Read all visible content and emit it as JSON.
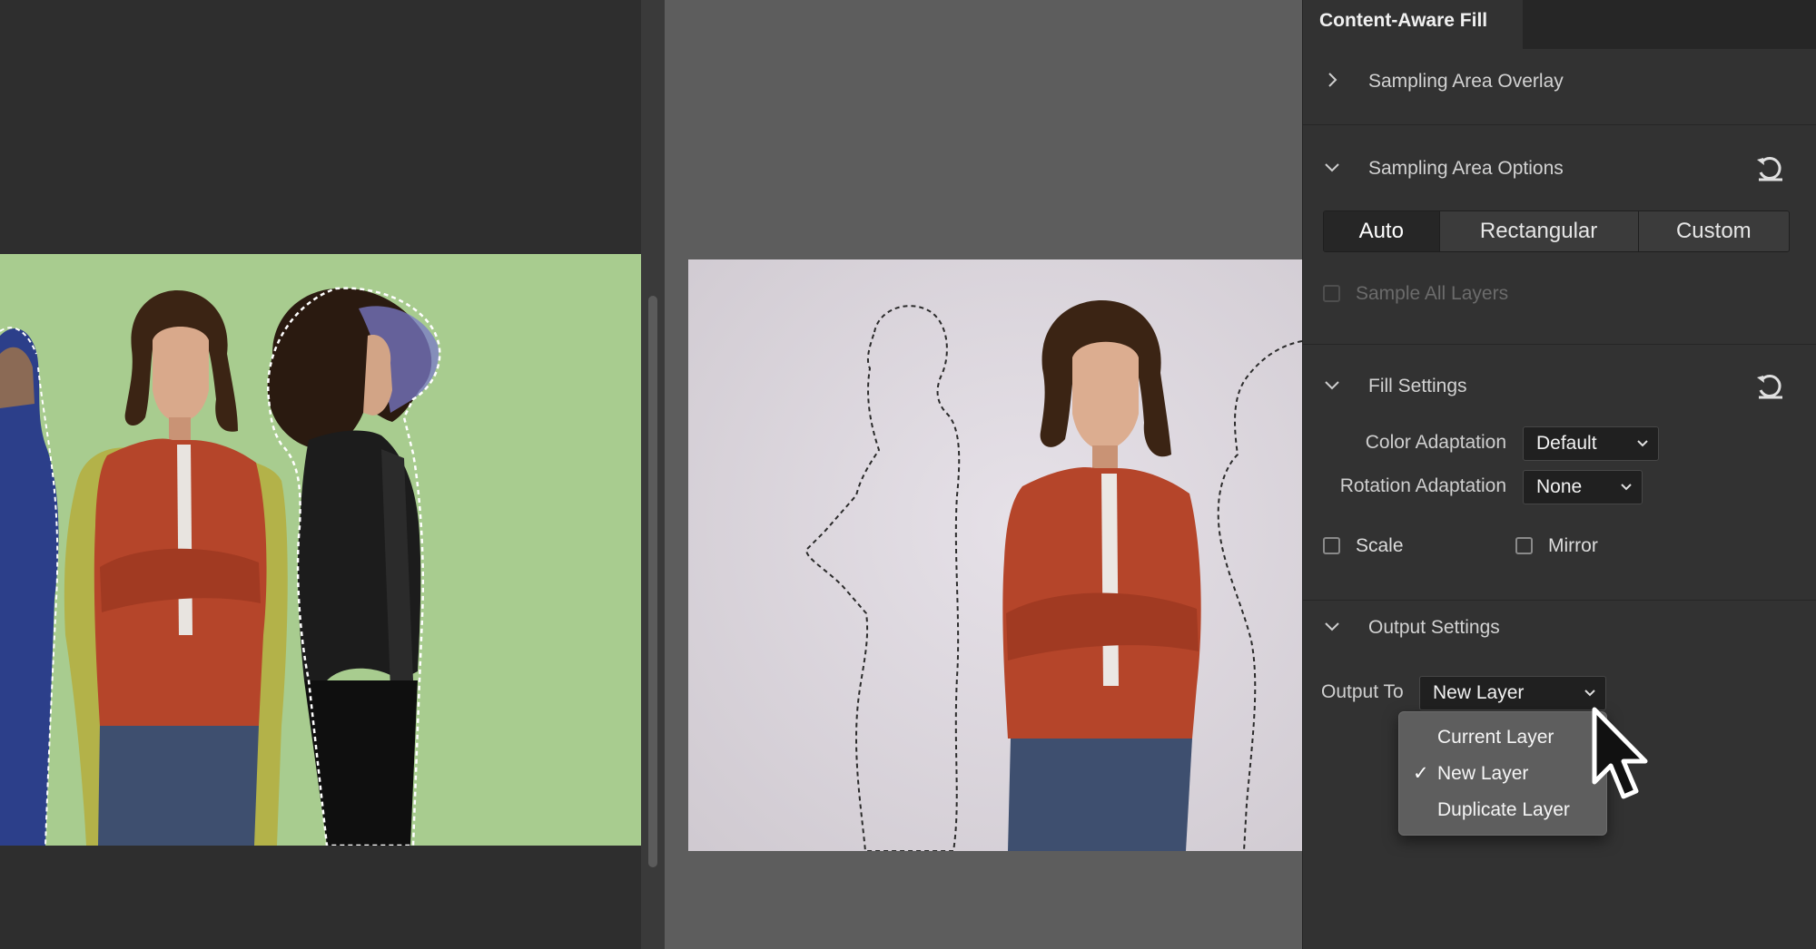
{
  "panel": {
    "title": "Content-Aware Fill",
    "sections": {
      "overlay": {
        "title": "Sampling Area Overlay"
      },
      "sampling": {
        "title": "Sampling Area Options",
        "modes": [
          "Auto",
          "Rectangular",
          "Custom"
        ],
        "selected_mode": "Auto",
        "sample_all_layers": {
          "label": "Sample All Layers",
          "checked": false,
          "enabled": false
        }
      },
      "fill": {
        "title": "Fill Settings",
        "color_adaptation": {
          "label": "Color Adaptation",
          "value": "Default"
        },
        "rotation_adaptation": {
          "label": "Rotation Adaptation",
          "value": "None"
        },
        "scale": {
          "label": "Scale",
          "checked": false
        },
        "mirror": {
          "label": "Mirror",
          "checked": false
        }
      },
      "output": {
        "title": "Output Settings",
        "output_to": {
          "label": "Output To",
          "value": "New Layer"
        },
        "menu_options": [
          "Current Layer",
          "New Layer",
          "Duplicate Layer"
        ],
        "menu_selected": "New Layer"
      }
    }
  },
  "icons": {
    "reset": "reset-icon",
    "chevron_right": "chevron-right-icon",
    "chevron_down": "chevron-down-icon",
    "cursor": "mouse-pointer-icon"
  },
  "colors": {
    "panel_bg": "#323232",
    "left_canvas_bg": "#a8cc8f",
    "right_canvas_bg": "#d8d3da",
    "sampling_overlay": "#b5ad3d",
    "exclude_overlay": "#7a79c8",
    "jacket": "#b5452a"
  }
}
